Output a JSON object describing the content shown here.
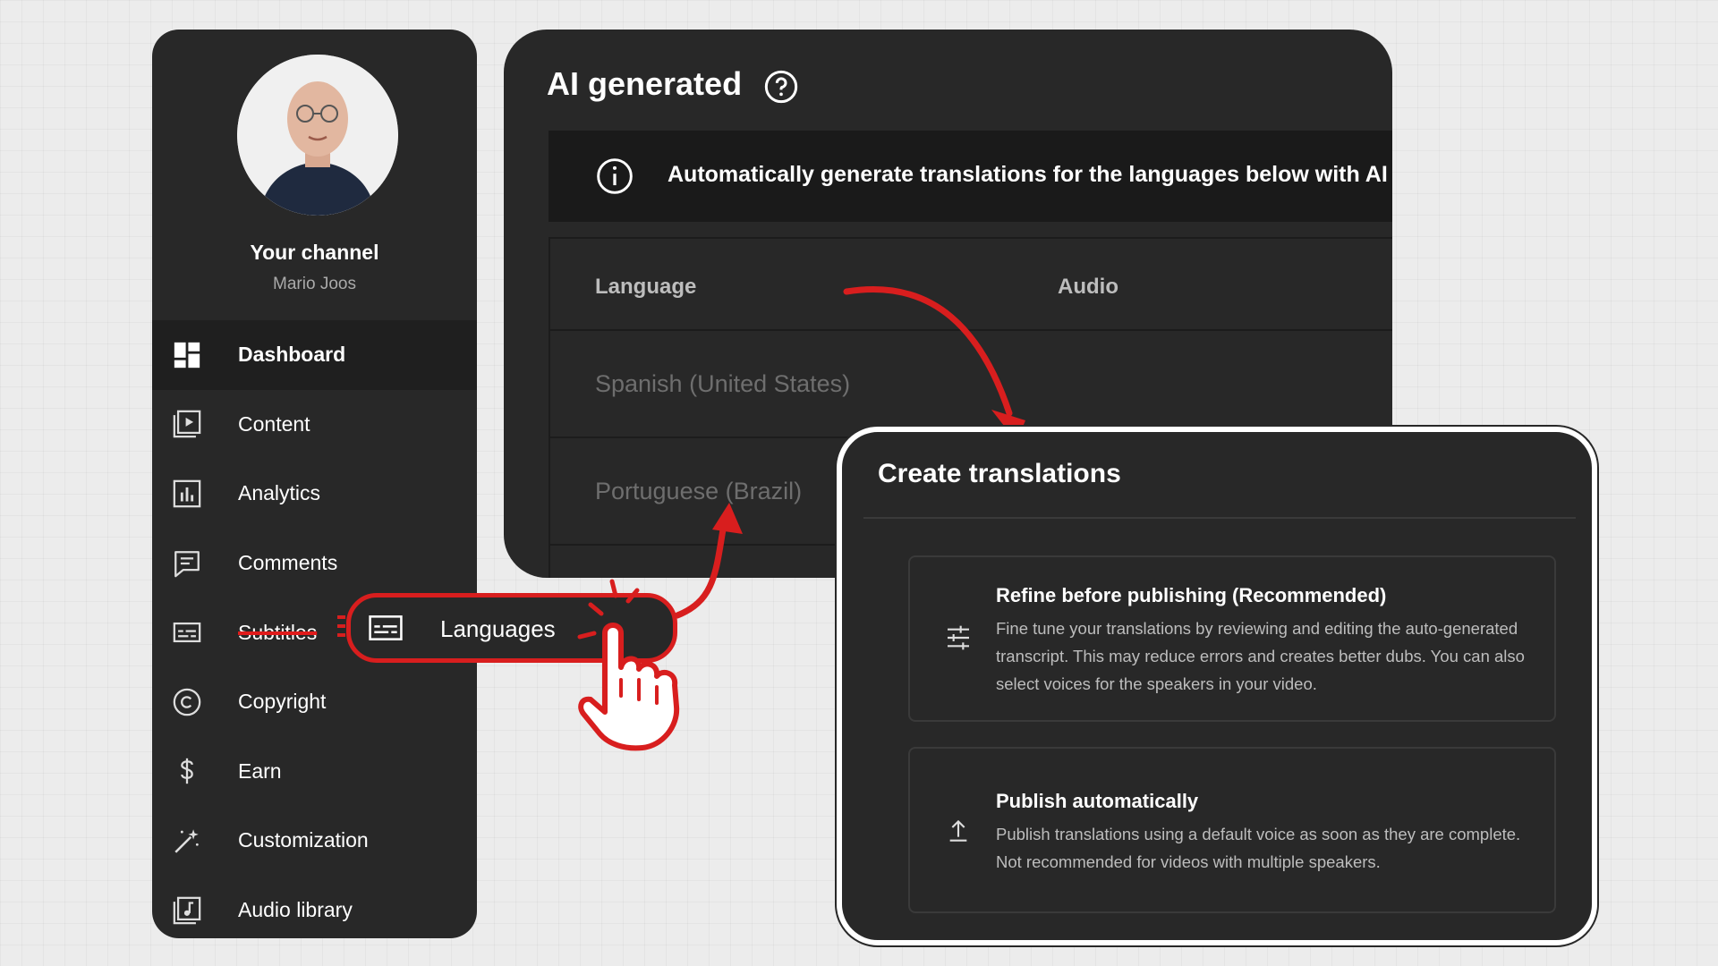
{
  "sidebar": {
    "channel_title": "Your channel",
    "channel_name": "Mario Joos",
    "items": [
      {
        "label": "Dashboard",
        "icon": "dashboard-icon"
      },
      {
        "label": "Content",
        "icon": "content-icon"
      },
      {
        "label": "Analytics",
        "icon": "analytics-icon"
      },
      {
        "label": "Comments",
        "icon": "comments-icon"
      },
      {
        "label": "Subtitles",
        "icon": "subtitles-icon"
      },
      {
        "label": "Copyright",
        "icon": "copyright-icon"
      },
      {
        "label": "Earn",
        "icon": "earn-icon"
      },
      {
        "label": "Customization",
        "icon": "customization-icon"
      },
      {
        "label": "Audio library",
        "icon": "audio-library-icon"
      }
    ]
  },
  "callout": {
    "label": "Languages",
    "icon": "languages-icon"
  },
  "ai_panel": {
    "title": "AI generated",
    "banner_text": "Automatically generate translations for the languages below with AI",
    "columns": {
      "language": "Language",
      "audio": "Audio"
    },
    "rows": [
      {
        "language": "Spanish (United States)"
      },
      {
        "language": "Portuguese (Brazil)"
      }
    ]
  },
  "dialog": {
    "title": "Create translations",
    "options": [
      {
        "title": "Refine before publishing (Recommended)",
        "description": "Fine tune your translations by reviewing and editing the auto-generated transcript. This may reduce errors and creates better dubs. You can also select voices for the speakers in your video.",
        "icon": "tune-icon"
      },
      {
        "title": "Publish automatically",
        "description": "Publish translations using a default voice as soon as they are complete. Not recommended for videos with multiple speakers.",
        "icon": "upload-icon"
      }
    ]
  },
  "colors": {
    "panel_bg": "#282828",
    "accent_red": "#d81e1e",
    "page_bg": "#ececec"
  }
}
